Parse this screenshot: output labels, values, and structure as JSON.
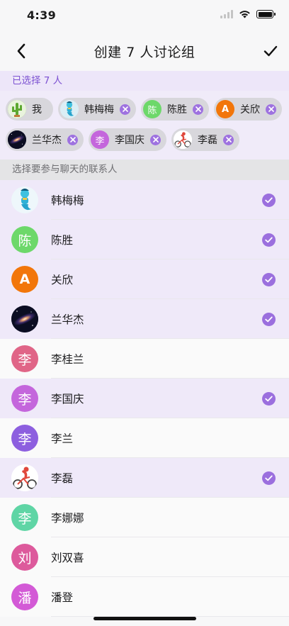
{
  "status": {
    "time": "4:39"
  },
  "nav": {
    "title": "创建 7 人讨论组"
  },
  "selected_header": "已选择 7 人",
  "chips": [
    {
      "label": "我",
      "avatar": "cactus",
      "avatar_text": "",
      "avatar_color": "#6fb13c",
      "removable": false
    },
    {
      "label": "韩梅梅",
      "avatar": "genie",
      "avatar_text": "",
      "avatar_color": "#dbeef5",
      "removable": true
    },
    {
      "label": "陈胜",
      "avatar": "text",
      "avatar_text": "陈",
      "avatar_color": "#6dd86a",
      "removable": true
    },
    {
      "label": "关欣",
      "avatar": "letter-a",
      "avatar_text": "A",
      "avatar_color": "#f2760a",
      "removable": true
    },
    {
      "label": "兰华杰",
      "avatar": "galaxy",
      "avatar_text": "",
      "avatar_color": "#1b1f3b",
      "removable": true
    },
    {
      "label": "李国庆",
      "avatar": "text",
      "avatar_text": "李",
      "avatar_color": "#c466dc",
      "removable": true
    },
    {
      "label": "李磊",
      "avatar": "cyclist",
      "avatar_text": "",
      "avatar_color": "#ffffff",
      "removable": true
    }
  ],
  "contacts_header": "选择要参与聊天的联系人",
  "contacts": [
    {
      "name": "韩梅梅",
      "avatar": "genie",
      "avatar_text": "",
      "avatar_color": "#eef7fb",
      "selected": true
    },
    {
      "name": "陈胜",
      "avatar": "text",
      "avatar_text": "陈",
      "avatar_color": "#6dd86a",
      "selected": true
    },
    {
      "name": "关欣",
      "avatar": "letter-a",
      "avatar_text": "A",
      "avatar_color": "#f2760a",
      "selected": true
    },
    {
      "name": "兰华杰",
      "avatar": "galaxy",
      "avatar_text": "",
      "avatar_color": "#1b1f3b",
      "selected": true
    },
    {
      "name": "李桂兰",
      "avatar": "text",
      "avatar_text": "李",
      "avatar_color": "#e06587",
      "selected": false
    },
    {
      "name": "李国庆",
      "avatar": "text",
      "avatar_text": "李",
      "avatar_color": "#c466dc",
      "selected": true
    },
    {
      "name": "李兰",
      "avatar": "text",
      "avatar_text": "李",
      "avatar_color": "#8d5fdf",
      "selected": false
    },
    {
      "name": "李磊",
      "avatar": "cyclist",
      "avatar_text": "",
      "avatar_color": "#ffffff",
      "selected": true
    },
    {
      "name": "李娜娜",
      "avatar": "text",
      "avatar_text": "李",
      "avatar_color": "#5fd5a5",
      "selected": false
    },
    {
      "name": "刘双喜",
      "avatar": "text",
      "avatar_text": "刘",
      "avatar_color": "#dd5a9c",
      "selected": false
    },
    {
      "name": "潘登",
      "avatar": "text",
      "avatar_text": "潘",
      "avatar_color": "#d35ad6",
      "selected": false
    }
  ],
  "accent_color": "#9b6fde"
}
